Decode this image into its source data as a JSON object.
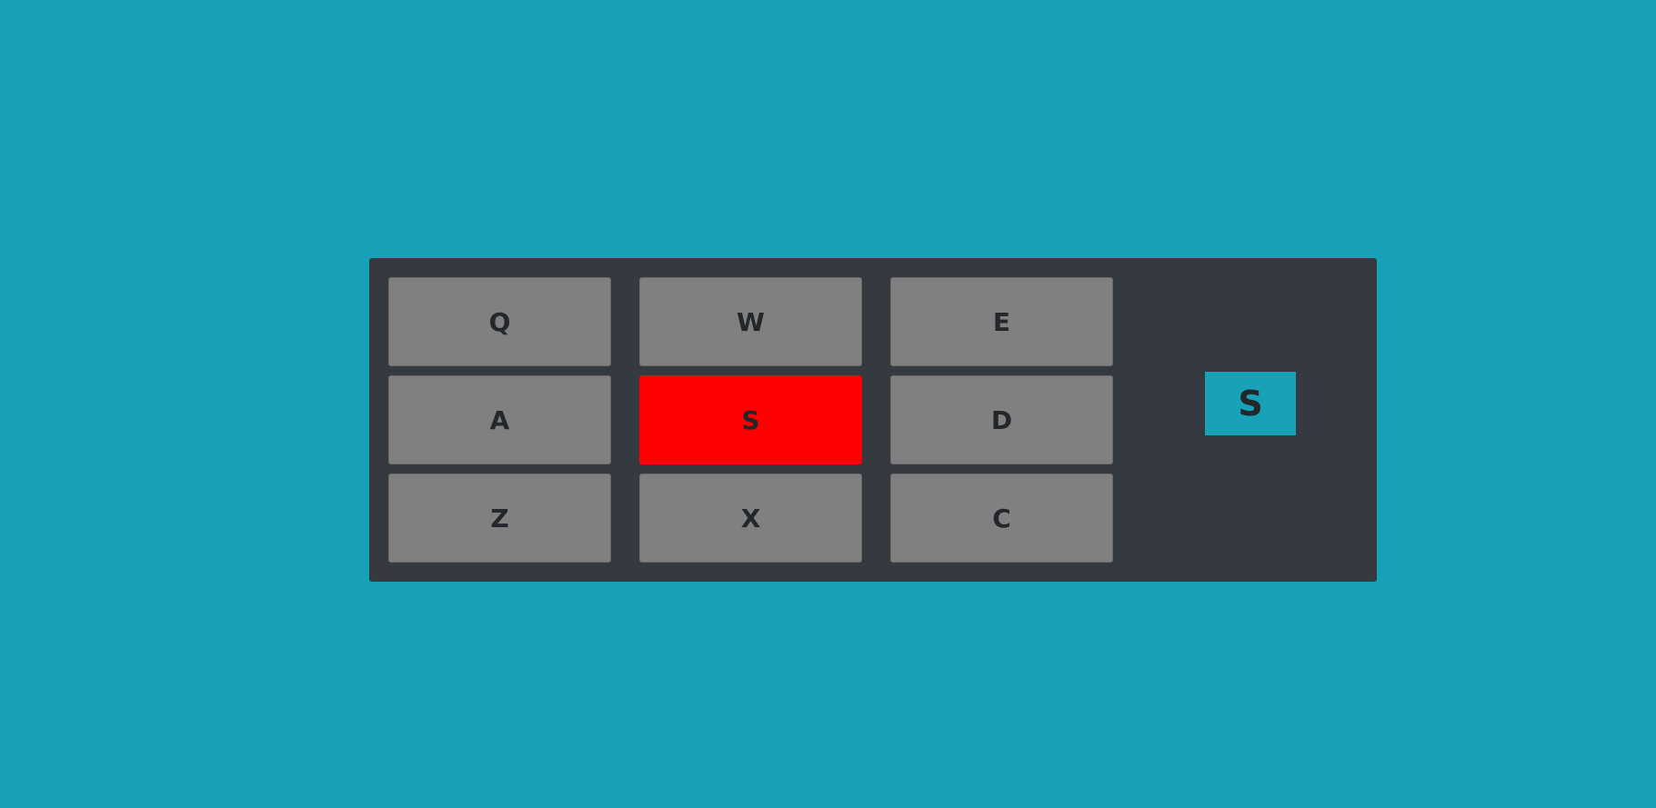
{
  "colors": {
    "background": "#17a2b8",
    "panel": "#343a40",
    "key": "#808080",
    "key_active": "#ff0000",
    "text": "#23272b",
    "display_background": "#17a2b8"
  },
  "drum_pad": {
    "keys": [
      {
        "label": "Q",
        "active": false
      },
      {
        "label": "W",
        "active": false
      },
      {
        "label": "E",
        "active": false
      },
      {
        "label": "A",
        "active": false
      },
      {
        "label": "S",
        "active": true
      },
      {
        "label": "D",
        "active": false
      },
      {
        "label": "Z",
        "active": false
      },
      {
        "label": "X",
        "active": false
      },
      {
        "label": "C",
        "active": false
      }
    ],
    "display_text": "S"
  }
}
